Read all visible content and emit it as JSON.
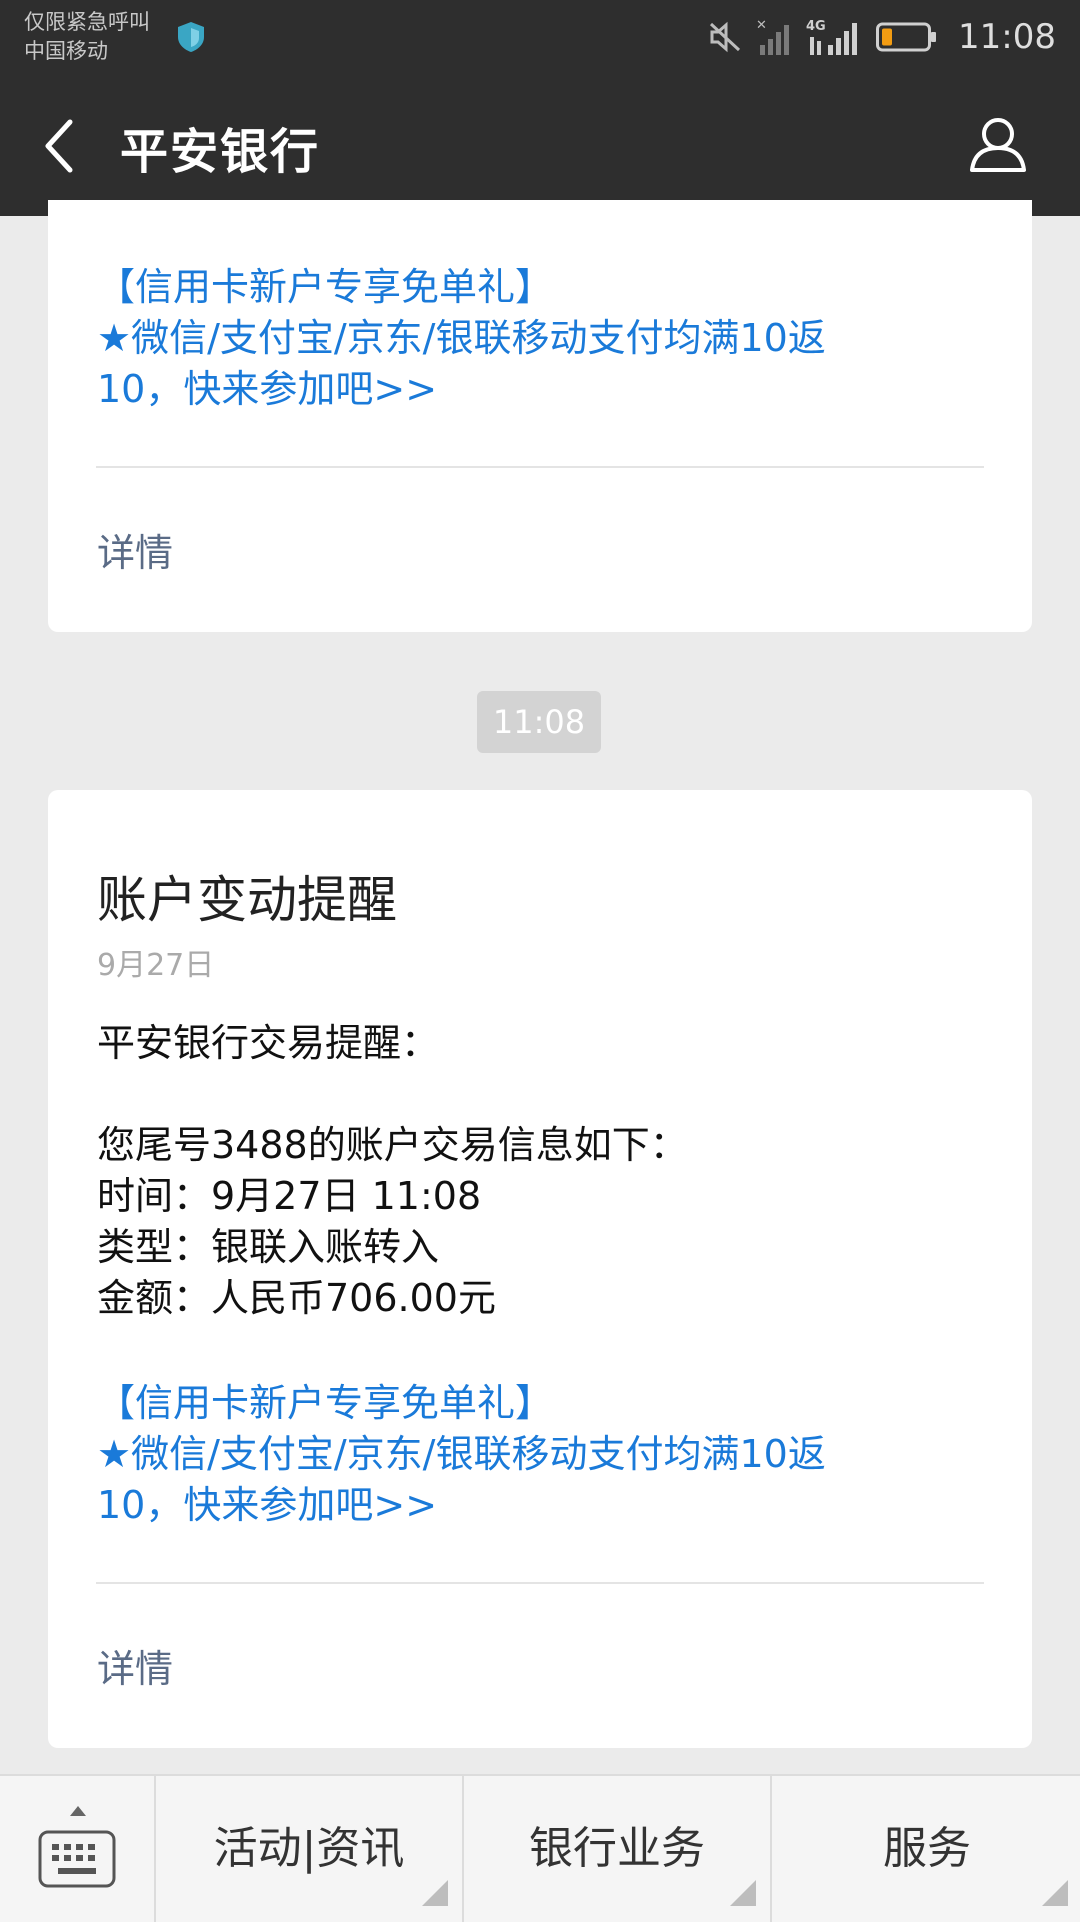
{
  "status_bar": {
    "carrier_line1": "仅限紧急呼叫",
    "carrier_line2": "中国移动",
    "network": "4G",
    "time": "11:08",
    "icons": [
      "shield-icon",
      "mute-icon",
      "no-signal-icon",
      "signal-icon",
      "battery-icon"
    ]
  },
  "header": {
    "title": "平安银行",
    "back_icon": "back-icon",
    "profile_icon": "profile-icon"
  },
  "messages": [
    {
      "promo_lines": [
        "【信用卡新户专享免单礼】",
        "★微信/支付宝/京东/银联移动支付均满10返",
        "10，快来参加吧>>"
      ],
      "detail_label": "详情"
    },
    {
      "time_chip": "11:08",
      "title": "账户变动提醒",
      "date": "9月27日",
      "greeting": "平安银行交易提醒：",
      "body_lines": [
        "您尾号3488的账户交易信息如下：",
        "时间：9月27日 11:08",
        "类型：银联入账转入",
        "金额：人民币706.00元"
      ],
      "promo_lines": [
        "【信用卡新户专享免单礼】",
        "★微信/支付宝/京东/银联移动支付均满10返",
        "10，快来参加吧>>"
      ],
      "detail_label": "详情"
    }
  ],
  "bottom_menu": {
    "keyboard_icon": "keyboard-icon",
    "items": [
      {
        "label": "活动|资讯"
      },
      {
        "label": "银行业务"
      },
      {
        "label": "服务"
      }
    ]
  },
  "colors": {
    "header_bg": "#2e2e2e",
    "link_blue": "#1a7ad9",
    "page_bg": "#ebebeb",
    "battery_orange": "#f39c12",
    "shield_teal": "#3aa6c4"
  }
}
